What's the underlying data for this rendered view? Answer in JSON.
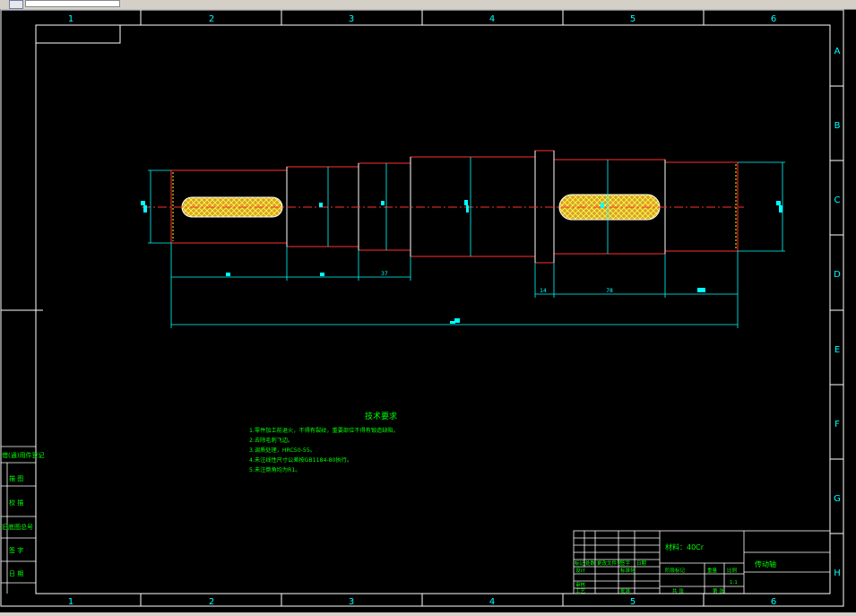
{
  "window": {
    "tab_icon": "document-icon"
  },
  "drawing": {
    "column_labels": [
      "1",
      "2",
      "3",
      "4",
      "5",
      "6"
    ],
    "row_labels": [
      "A",
      "B",
      "C",
      "D",
      "E",
      "F",
      "G",
      "H"
    ],
    "dimensions": {
      "d_37": "37",
      "d_14": "14",
      "d_78": "78"
    },
    "tech_requirements": {
      "title": "技术要求",
      "items": [
        "1.零件加工前退火，不得有裂纹，重要部位不得有锻造缺陷。",
        "2.去除毛刺飞边。",
        "3.调质处理，HRC50-55。",
        "4.未注线性尺寸公差按GB1184-80执行。",
        "5.未注倒角均为R1。"
      ]
    },
    "left_strip_labels": [
      "借(通)用件登记",
      "描 图",
      "校 描",
      "旧底图总号",
      "签 字",
      "日 期"
    ],
    "title_block": {
      "material": "材料：40Cr",
      "drawing_name": "传动轴",
      "scale": "1:1",
      "labels_small": [
        "标记",
        "处数",
        "更改文件号",
        "签字",
        "日期"
      ],
      "labels_row2": [
        "设计",
        "标准化"
      ],
      "labels_row3": [
        "审核"
      ],
      "labels_row4": [
        "工艺",
        "批准",
        "共 张",
        "第 张"
      ],
      "stage_labels": [
        "阶段标记",
        "重量",
        "比例"
      ]
    }
  },
  "colors": {
    "frame": "#ffffff",
    "dim": "#00ffff",
    "outline": "#ff2020",
    "center": "#ff3030",
    "hatch": "#ffff00",
    "text": "#00ff00"
  }
}
